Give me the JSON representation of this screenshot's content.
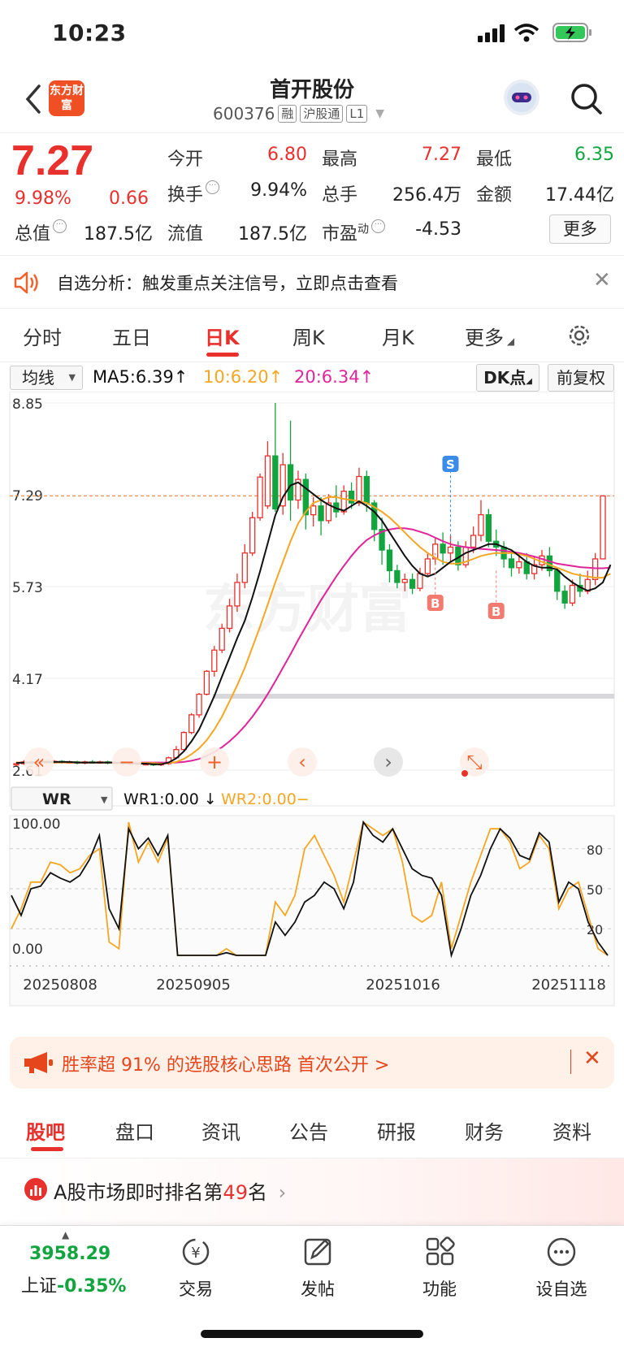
{
  "status_bar": {
    "time": "10:23"
  },
  "header": {
    "logo_text": "东方财富",
    "title": "首开股份",
    "code": "600376",
    "tags": [
      "融",
      "沪股通",
      "L1"
    ]
  },
  "quote": {
    "price": "7.27",
    "change_pct": "9.98%",
    "change": "0.66",
    "fields": [
      {
        "label": "今开",
        "value": "6.80",
        "color": "#e8312d"
      },
      {
        "label": "最高",
        "value": "7.27",
        "color": "#e8312d"
      },
      {
        "label": "最低",
        "value": "6.35",
        "color": "#12a53f"
      },
      {
        "label": "换手",
        "value": "9.94%",
        "color": "#222222"
      },
      {
        "label": "总手",
        "value": "256.4万",
        "color": "#222222"
      },
      {
        "label": "金额",
        "value": "17.44亿",
        "color": "#222222"
      },
      {
        "label": "总值",
        "value": "187.5亿",
        "color": "#222222"
      },
      {
        "label": "流值",
        "value": "187.5亿",
        "color": "#222222"
      },
      {
        "label": "市盈",
        "value": "-4.53",
        "color": "#222222"
      }
    ],
    "pe_superscript": "动",
    "more_label": "更多"
  },
  "alert": {
    "text": "自选分析：触发重点关注信号，立即点击查看"
  },
  "period_tabs": [
    "分时",
    "五日",
    "日K",
    "周K",
    "月K",
    "更多"
  ],
  "active_period": "日K",
  "chart_controls": {
    "indicator": "均线",
    "ma5": "MA5:6.39",
    "ma10": "10:6.20",
    "ma20": "20:6.34",
    "dk_label": "DK点",
    "adjust_label": "前复权",
    "watermark": "东方财富",
    "wr_indicator": "WR",
    "wr1": "WR1:0.00",
    "wr2": "WR2:0.00",
    "s_marker": "S",
    "b_marker": "B"
  },
  "colors": {
    "up": "#e8312d",
    "down": "#12a53f",
    "ma5": "#111111",
    "ma10": "#f5a623",
    "ma20": "#e0249a",
    "accent": "#e8312d"
  },
  "chart_data": [
    {
      "type": "candlestick",
      "y_ticks": [
        "8.85",
        "7.29",
        "5.73",
        "4.17",
        "2.61"
      ],
      "ylim": [
        2.61,
        8.85
      ],
      "x_ticks": [
        "20250808",
        "20250905",
        "20251016",
        "20251118"
      ],
      "candles": [
        [
          2.7,
          2.72,
          2.68,
          2.74
        ],
        [
          2.72,
          2.75,
          2.7,
          2.78
        ],
        [
          2.75,
          2.73,
          2.7,
          2.78
        ],
        [
          2.73,
          2.76,
          2.71,
          2.8
        ],
        [
          2.76,
          2.74,
          2.72,
          2.79
        ],
        [
          2.74,
          2.76,
          2.72,
          2.78
        ],
        [
          2.76,
          2.74,
          2.72,
          2.78
        ],
        [
          2.74,
          2.75,
          2.72,
          2.77
        ],
        [
          2.75,
          2.73,
          2.71,
          2.77
        ],
        [
          2.73,
          2.75,
          2.71,
          2.77
        ],
        [
          2.75,
          2.74,
          2.72,
          2.78
        ],
        [
          2.74,
          2.75,
          2.72,
          2.77
        ],
        [
          2.75,
          2.73,
          2.71,
          2.77
        ],
        [
          2.73,
          2.74,
          2.71,
          2.76
        ],
        [
          2.74,
          2.72,
          2.7,
          2.76
        ],
        [
          2.72,
          2.73,
          2.7,
          2.75
        ],
        [
          2.73,
          2.71,
          2.69,
          2.75
        ],
        [
          2.71,
          2.72,
          2.69,
          2.74
        ],
        [
          2.72,
          2.7,
          2.68,
          2.74
        ],
        [
          2.7,
          2.72,
          2.68,
          2.74
        ],
        [
          2.72,
          2.82,
          2.7,
          2.84
        ],
        [
          2.82,
          2.96,
          2.8,
          3.02
        ],
        [
          2.96,
          3.25,
          2.94,
          3.27
        ],
        [
          3.25,
          3.55,
          3.22,
          3.58
        ],
        [
          3.55,
          3.9,
          3.5,
          3.92
        ],
        [
          3.9,
          4.29,
          3.88,
          4.31
        ],
        [
          4.29,
          4.65,
          4.2,
          4.72
        ],
        [
          4.65,
          5.02,
          4.6,
          5.1
        ],
        [
          5.02,
          5.4,
          4.95,
          5.52
        ],
        [
          5.4,
          5.8,
          5.3,
          5.95
        ],
        [
          5.8,
          6.3,
          5.7,
          6.45
        ],
        [
          6.3,
          6.9,
          6.25,
          7.0
        ],
        [
          6.9,
          7.59,
          6.85,
          7.65
        ],
        [
          7.1,
          7.95,
          7.05,
          8.2
        ],
        [
          7.95,
          7.05,
          7.0,
          8.85
        ],
        [
          7.1,
          7.8,
          6.95,
          8.0
        ],
        [
          7.8,
          7.2,
          6.85,
          8.55
        ],
        [
          7.2,
          7.55,
          7.05,
          7.7
        ],
        [
          7.55,
          6.95,
          6.7,
          7.65
        ],
        [
          6.95,
          7.1,
          6.75,
          7.25
        ],
        [
          7.1,
          6.85,
          6.6,
          7.25
        ],
        [
          6.85,
          7.15,
          6.8,
          7.3
        ],
        [
          7.15,
          7.0,
          6.9,
          7.45
        ],
        [
          7.0,
          7.35,
          6.95,
          7.45
        ],
        [
          7.35,
          7.15,
          7.05,
          7.5
        ],
        [
          7.15,
          7.6,
          7.1,
          7.75
        ],
        [
          7.6,
          7.15,
          7.0,
          7.7
        ],
        [
          7.15,
          6.7,
          6.5,
          7.2
        ],
        [
          6.7,
          6.35,
          6.1,
          6.9
        ],
        [
          6.35,
          6.0,
          5.8,
          6.45
        ],
        [
          6.0,
          5.8,
          5.7,
          6.1
        ],
        [
          5.8,
          5.85,
          5.65,
          5.95
        ],
        [
          5.85,
          5.7,
          5.6,
          5.95
        ],
        [
          5.7,
          5.95,
          5.65,
          6.05
        ],
        [
          5.95,
          6.2,
          5.9,
          6.3
        ],
        [
          6.2,
          6.45,
          6.1,
          6.55
        ],
        [
          6.45,
          6.3,
          6.1,
          6.65
        ],
        [
          6.3,
          6.4,
          6.15,
          6.6
        ],
        [
          6.4,
          6.1,
          6.0,
          6.5
        ],
        [
          6.1,
          6.4,
          6.05,
          6.5
        ],
        [
          6.4,
          6.6,
          6.3,
          6.75
        ],
        [
          6.6,
          6.95,
          6.5,
          7.2
        ],
        [
          6.95,
          6.5,
          6.4,
          7.05
        ],
        [
          6.5,
          6.4,
          6.25,
          6.7
        ],
        [
          6.4,
          6.2,
          6.05,
          6.5
        ],
        [
          6.2,
          6.05,
          5.9,
          6.3
        ],
        [
          6.05,
          6.15,
          5.95,
          6.25
        ],
        [
          6.15,
          5.95,
          5.85,
          6.3
        ],
        [
          5.95,
          6.1,
          5.85,
          6.25
        ],
        [
          6.1,
          6.25,
          6.0,
          6.35
        ],
        [
          6.25,
          6.0,
          5.9,
          6.4
        ],
        [
          6.0,
          5.65,
          5.5,
          6.05
        ],
        [
          5.65,
          5.45,
          5.35,
          5.75
        ],
        [
          5.45,
          5.75,
          5.4,
          5.85
        ],
        [
          5.75,
          5.65,
          5.55,
          5.95
        ],
        [
          5.65,
          5.85,
          5.6,
          6.0
        ],
        [
          5.85,
          6.2,
          5.75,
          6.3
        ],
        [
          6.2,
          7.27,
          6.35,
          7.27
        ]
      ],
      "ma5": [
        2.73,
        2.74,
        2.74,
        2.75,
        2.75,
        2.75,
        2.75,
        2.75,
        2.74,
        2.74,
        2.74,
        2.74,
        2.74,
        2.74,
        2.73,
        2.73,
        2.72,
        2.72,
        2.71,
        2.71,
        2.74,
        2.81,
        2.93,
        3.1,
        3.3,
        3.58,
        3.87,
        4.2,
        4.52,
        4.85,
        5.15,
        5.55,
        5.99,
        6.46,
        6.94,
        7.25,
        7.45,
        7.5,
        7.4,
        7.3,
        7.2,
        7.12,
        7.06,
        7.02,
        7.1,
        7.18,
        7.1,
        7.0,
        6.85,
        6.65,
        6.45,
        6.25,
        6.08,
        5.95,
        5.9,
        5.95,
        6.05,
        6.15,
        6.22,
        6.3,
        6.35,
        6.4,
        6.45,
        6.45,
        6.4,
        6.35,
        6.25,
        6.15,
        6.08,
        6.05,
        6.05,
        6.02,
        5.9,
        5.8,
        5.72,
        5.66,
        5.7,
        5.8,
        6.1
      ],
      "ma10": [
        2.74,
        2.74,
        2.74,
        2.74,
        2.74,
        2.74,
        2.74,
        2.74,
        2.74,
        2.74,
        2.74,
        2.74,
        2.74,
        2.74,
        2.74,
        2.74,
        2.73,
        2.73,
        2.73,
        2.72,
        2.73,
        2.75,
        2.8,
        2.88,
        2.98,
        3.12,
        3.3,
        3.52,
        3.78,
        4.05,
        4.35,
        4.7,
        5.05,
        5.42,
        5.8,
        6.15,
        6.5,
        6.8,
        7.0,
        7.15,
        7.2,
        7.25,
        7.25,
        7.22,
        7.2,
        7.18,
        7.15,
        7.08,
        7.0,
        6.9,
        6.78,
        6.65,
        6.52,
        6.4,
        6.3,
        6.22,
        6.15,
        6.12,
        6.12,
        6.15,
        6.2,
        6.25,
        6.28,
        6.3,
        6.3,
        6.3,
        6.28,
        6.25,
        6.2,
        6.15,
        6.1,
        6.05,
        6.0,
        5.95,
        5.92,
        5.9,
        5.88,
        5.88,
        5.95
      ],
      "ma20": [
        2.74,
        2.74,
        2.74,
        2.74,
        2.74,
        2.74,
        2.74,
        2.74,
        2.74,
        2.74,
        2.74,
        2.74,
        2.74,
        2.74,
        2.74,
        2.74,
        2.74,
        2.74,
        2.74,
        2.74,
        2.74,
        2.74,
        2.75,
        2.77,
        2.8,
        2.85,
        2.92,
        3.0,
        3.1,
        3.22,
        3.36,
        3.52,
        3.7,
        3.9,
        4.12,
        4.35,
        4.58,
        4.82,
        5.05,
        5.28,
        5.5,
        5.7,
        5.9,
        6.08,
        6.25,
        6.4,
        6.52,
        6.6,
        6.66,
        6.7,
        6.72,
        6.72,
        6.7,
        6.66,
        6.62,
        6.56,
        6.5,
        6.45,
        6.42,
        6.4,
        6.38,
        6.37,
        6.36,
        6.35,
        6.34,
        6.32,
        6.3,
        6.27,
        6.24,
        6.2,
        6.16,
        6.12,
        6.1,
        6.08,
        6.06,
        6.05,
        6.04,
        6.04,
        6.05
      ]
    },
    {
      "type": "line",
      "ylim": [
        0,
        100
      ],
      "y_ticks": [
        "100.00",
        "0.00"
      ],
      "right_ticks": [
        "80",
        "50",
        "20"
      ],
      "series": [
        {
          "name": "WR1",
          "values": [
            45,
            30,
            50,
            52,
            62,
            58,
            55,
            60,
            72,
            90,
            35,
            20,
            95,
            80,
            88,
            75,
            90,
            0,
            0,
            0,
            0,
            0,
            2,
            0,
            0,
            0,
            0,
            25,
            15,
            25,
            40,
            45,
            55,
            50,
            35,
            55,
            100,
            90,
            85,
            95,
            80,
            65,
            60,
            58,
            45,
            0,
            20,
            45,
            60,
            80,
            95,
            88,
            75,
            72,
            92,
            85,
            40,
            55,
            50,
            25,
            10,
            0
          ]
        },
        {
          "name": "WR2",
          "values": [
            20,
            35,
            55,
            55,
            70,
            68,
            62,
            65,
            75,
            80,
            10,
            5,
            100,
            70,
            85,
            70,
            88,
            0,
            0,
            0,
            0,
            0,
            5,
            0,
            0,
            0,
            0,
            40,
            30,
            45,
            80,
            90,
            75,
            60,
            40,
            70,
            100,
            95,
            90,
            95,
            70,
            30,
            25,
            30,
            55,
            5,
            30,
            55,
            75,
            95,
            95,
            85,
            65,
            70,
            90,
            80,
            35,
            50,
            55,
            30,
            5,
            0
          ]
        }
      ]
    }
  ],
  "banner": {
    "text": "胜率超 91% 的选股核心思路 首次公开 >"
  },
  "bottom_tabs": [
    "股吧",
    "盘口",
    "资讯",
    "公告",
    "研报",
    "财务",
    "资料"
  ],
  "rank": {
    "prefix": "A股市场即时排名第",
    "number": "49",
    "suffix": "名"
  },
  "nav": {
    "index_value": "3958.29",
    "index_name": "上证",
    "index_change": "-0.35%",
    "items": [
      "交易",
      "发帖",
      "功能",
      "设自选"
    ]
  }
}
